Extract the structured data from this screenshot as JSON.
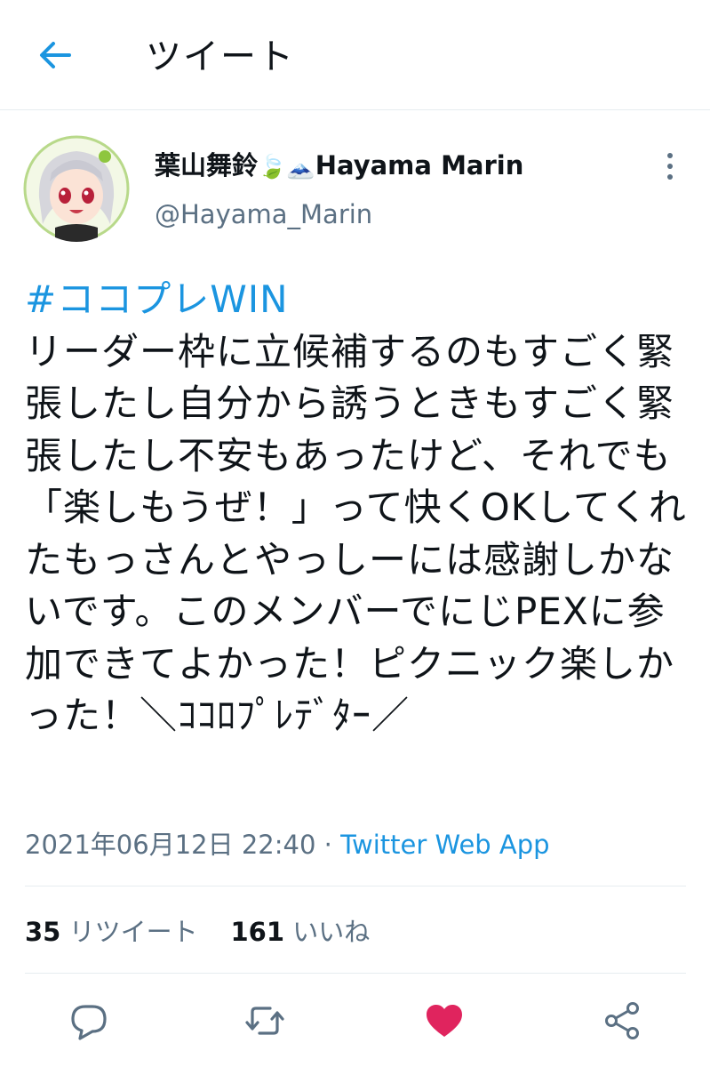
{
  "header": {
    "title": "ツイート",
    "back_icon": "arrow-left-icon"
  },
  "author": {
    "display_name": "葉山舞鈴",
    "emoji_1": "🍃",
    "emoji_2": "🗻",
    "display_name_latin": "Hayama Marin",
    "handle": "@Hayama_Marin",
    "avatar_icon": "avatar-image"
  },
  "tweet": {
    "hashtag": "#ココプレWIN",
    "text": "リーダー枠に立候補するのもすごく緊張したし自分から誘うときもすごく緊張したし不安もあったけど、それでも「楽しもうぜ！」って快くOKしてくれたもっさんとやっしーには感謝しかないです。このメンバーでにじPEXに参加できてよかった！ピクニック楽しかった！＼ｺｺﾛﾌﾟﾚﾃﾞﾀｰ／",
    "timestamp": "2021年06月12日 22:40",
    "separator": " · ",
    "source": "Twitter Web App"
  },
  "stats": {
    "retweets_count": "35",
    "retweets_label": "リツイート",
    "likes_count": "161",
    "likes_label": "いいね"
  },
  "actions": {
    "reply_icon": "reply-icon",
    "retweet_icon": "retweet-icon",
    "like_icon": "heart-icon",
    "share_icon": "share-icon"
  },
  "colors": {
    "accent": "#1b95e0",
    "like": "#e0245e",
    "secondary_text": "#5b7083",
    "divider": "#e6ecf0"
  }
}
